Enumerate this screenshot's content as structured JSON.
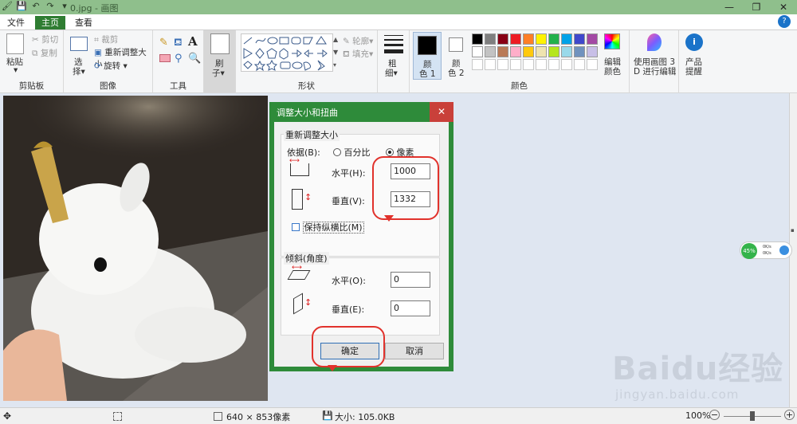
{
  "titlebar": {
    "title": "0.jpg - 画图",
    "minimize": "—",
    "maximize": "❐",
    "close": "✕"
  },
  "tabs": {
    "file": "文件",
    "home": "主页",
    "view": "查看"
  },
  "ribbon": {
    "clipboard": {
      "paste": "粘贴",
      "cut": "剪切",
      "copy": "复制",
      "label": "剪贴板"
    },
    "image": {
      "select": "选",
      "select2": "择",
      "crop": "裁剪",
      "resize": "重新调整大小",
      "rotate": "旋转",
      "label": "图像"
    },
    "tools": {
      "label": "工具"
    },
    "brushes": {
      "label1": "刷",
      "label2": "子"
    },
    "shapes": {
      "outline": "轮廓",
      "fill": "填充",
      "label": "形状"
    },
    "size": {
      "label1": "粗",
      "label2": "细"
    },
    "colors": {
      "color1_a": "颜",
      "color1_b": "色 1",
      "color2_a": "颜",
      "color2_b": "色 2",
      "edit_a": "编辑",
      "edit_b": "颜色",
      "label": "颜色",
      "palette_row1": [
        "#000000",
        "#7f7f7f",
        "#880015",
        "#ed1c24",
        "#ff7f27",
        "#fff200",
        "#22b14c",
        "#00a2e8",
        "#3f48cc",
        "#a349a4"
      ],
      "palette_row2": [
        "#ffffff",
        "#c3c3c3",
        "#b97a57",
        "#ffaec9",
        "#ffc90e",
        "#efe4b0",
        "#b5e61d",
        "#99d9ea",
        "#7092be",
        "#c8bfe7"
      ]
    },
    "paint3d": {
      "line1": "使用画图 3",
      "line2": "D 进行编辑"
    },
    "product": {
      "line1": "产品",
      "line2": "提醒"
    }
  },
  "dialog": {
    "title": "调整大小和扭曲",
    "resize_group": "重新调整大小",
    "by_label": "依据(B):",
    "percent": "百分比",
    "pixels": "像素",
    "horizontal": "水平(H):",
    "vertical": "垂直(V):",
    "h_value": "1000",
    "v_value": "1332",
    "keep_ratio": "保持纵横比(M)",
    "skew_group": "倾斜(角度)",
    "skew_h": "水平(O):",
    "skew_v": "垂直(E):",
    "skew_h_value": "0",
    "skew_v_value": "0",
    "ok": "确定",
    "cancel": "取消"
  },
  "statusbar": {
    "dimensions": "640 × 853像素",
    "size": "大小: 105.0KB",
    "zoom": "100%"
  },
  "netwidget": {
    "percent": "45%",
    "up": "0K/s",
    "down": "0K/s"
  },
  "watermark": {
    "brand": "Baidu经验",
    "url": "jingyan.baidu.com"
  }
}
